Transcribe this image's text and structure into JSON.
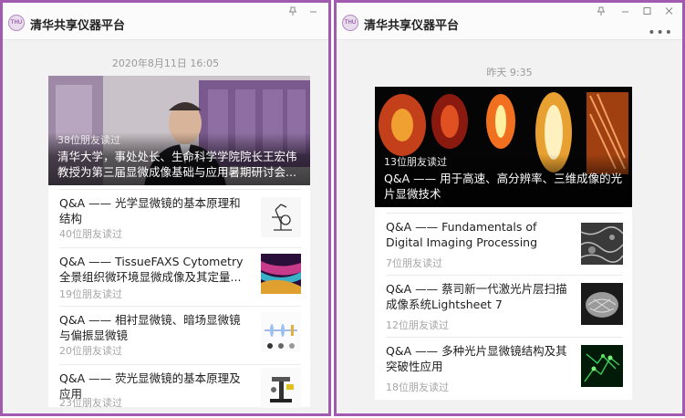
{
  "left": {
    "app_title": "清华共享仪器平台",
    "logo_text": "THU",
    "timestamp": "2020年8月11日 16:05",
    "hero": {
      "readers": "38位朋友读过",
      "title": "清华大学，事处处长、生命科学学院院长王宏伟教授为第三届显微成像基础与应用暑期研讨会..."
    },
    "items": [
      {
        "title": "Q&A —— 光学显微镜的基本原理和结构",
        "readers": "40位朋友读过",
        "thumb": "microscope-drawing"
      },
      {
        "title": "Q&A —— TissueFAXS Cytometry全景组织微环境显微成像及其定量...",
        "readers": "19位朋友读过",
        "thumb": "fluorescent-tissue"
      },
      {
        "title": "Q&A —— 相衬显微镜、暗场显微镜与偏振显微镜",
        "readers": "20位朋友读过",
        "thumb": "optics-diagram"
      },
      {
        "title": "Q&A —— 荧光显微镜的基本原理及应用",
        "readers": "23位朋友读过",
        "thumb": "fluorescence-microscope"
      }
    ]
  },
  "right": {
    "app_title": "清华共享仪器平台",
    "logo_text": "THU",
    "timestamp": "昨天 9:35",
    "hero": {
      "readers": "13位朋友读过",
      "title": "Q&A —— 用于高速、高分辨率、三维成像的光片显微技术"
    },
    "items": [
      {
        "title": "Q&A —— Fundamentals of Digital Imaging Processing",
        "readers": "7位朋友读过",
        "thumb": "grayscale-cells"
      },
      {
        "title": "Q&A —— 蔡司新一代激光片层扫描成像系统Lightsheet 7",
        "readers": "12位朋友读过",
        "thumb": "lightsheet-organ"
      },
      {
        "title": "Q&A —— 多种光片显微镜结构及其突破性应用",
        "readers": "18位朋友读过",
        "thumb": "green-neurons"
      }
    ]
  },
  "colors": {
    "frame_border": "#a05bb0",
    "background": "#f2f2f2",
    "card": "#ffffff",
    "muted_text": "#a6a6a6"
  },
  "window_controls": [
    "pin-icon",
    "minimize-icon",
    "maximize-icon",
    "close-icon"
  ]
}
